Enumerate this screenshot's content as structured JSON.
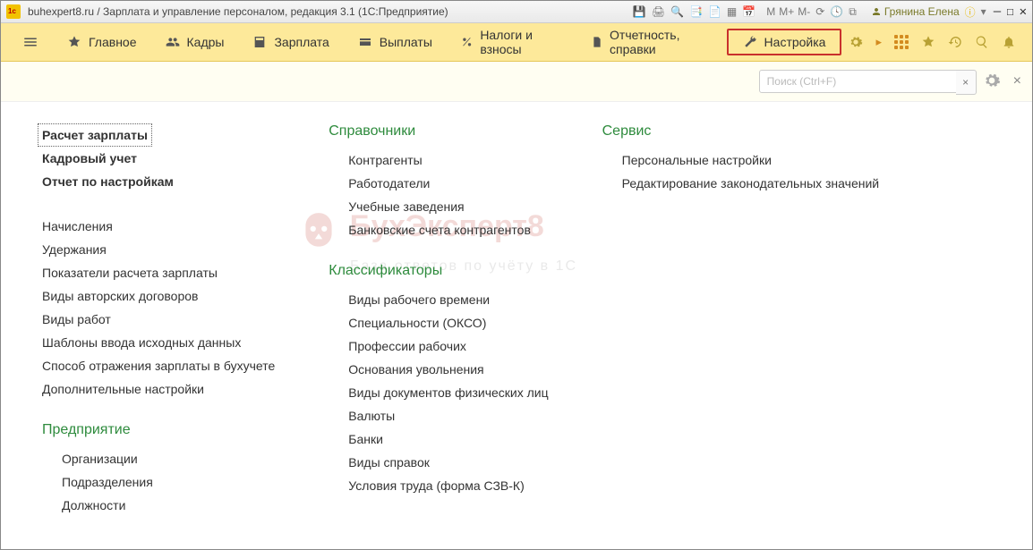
{
  "title": "buhexpert8.ru / Зарплата и управление персоналом, редакция 3.1  (1С:Предприятие)",
  "user": "Грянина Елена",
  "toolbar_text": {
    "m": "M",
    "m_plus": "M+",
    "m_minus": "M-"
  },
  "nav": [
    {
      "label": "Главное"
    },
    {
      "label": "Кадры"
    },
    {
      "label": "Зарплата"
    },
    {
      "label": "Выплаты"
    },
    {
      "label": "Налоги и взносы"
    },
    {
      "label": "Отчетность, справки"
    },
    {
      "label": "Настройка"
    }
  ],
  "search": {
    "placeholder": "Поиск (Ctrl+F)"
  },
  "watermark": {
    "title": "БухЭксперт8",
    "sub": "База ответов по учёту в 1С"
  },
  "col1": {
    "top": [
      "Расчет зарплаты",
      "Кадровый учет",
      "Отчет по настройкам"
    ],
    "mid": [
      "Начисления",
      "Удержания",
      "Показатели расчета зарплаты",
      "Виды авторских договоров",
      "Виды работ",
      "Шаблоны ввода исходных данных",
      "Способ отражения зарплаты в бухучете",
      "Дополнительные настройки"
    ],
    "enterprise_head": "Предприятие",
    "enterprise": [
      "Организации",
      "Подразделения",
      "Должности"
    ]
  },
  "col2": {
    "ref_head": "Справочники",
    "ref": [
      "Контрагенты",
      "Работодатели",
      "Учебные заведения",
      "Банковские счета контрагентов"
    ],
    "class_head": "Классификаторы",
    "class": [
      "Виды рабочего времени",
      "Специальности (ОКСО)",
      "Профессии рабочих",
      "Основания увольнения",
      "Виды документов физических лиц",
      "Валюты",
      "Банки",
      "Виды справок",
      "Условия труда (форма СЗВ-К)"
    ]
  },
  "col3": {
    "service_head": "Сервис",
    "service": [
      "Персональные настройки",
      "Редактирование законодательных значений"
    ]
  }
}
